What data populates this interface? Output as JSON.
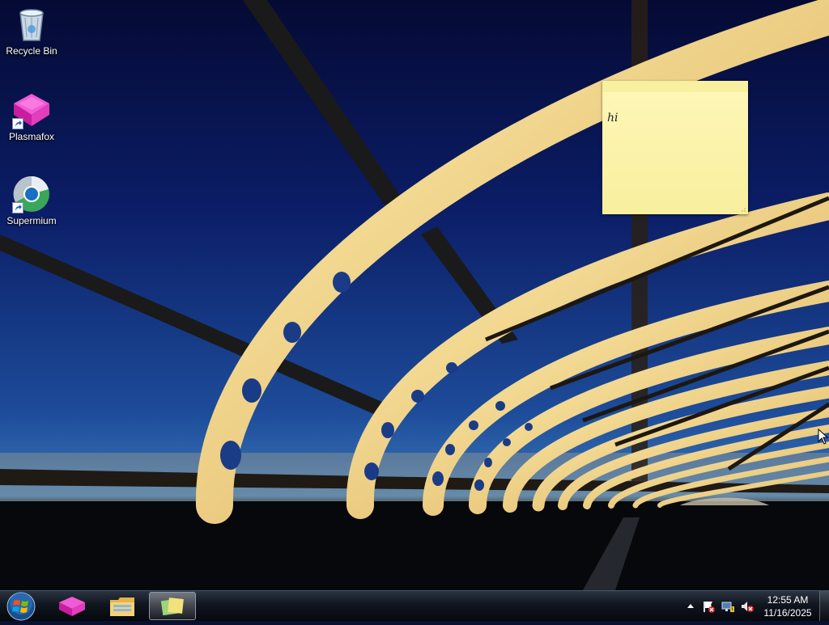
{
  "desktop": {
    "icons": [
      {
        "label": "Recycle Bin",
        "icon": "recycle-bin-icon"
      },
      {
        "label": "Plasmafox",
        "icon": "plasmafox-icon"
      },
      {
        "label": "Supermium",
        "icon": "supermium-icon"
      }
    ]
  },
  "sticky_note": {
    "text": "hi",
    "color": "#fdf6b6"
  },
  "taskbar": {
    "start_icon": "windows-start-orb-icon",
    "pinned": [
      {
        "app": "Plasmafox",
        "icon": "plasmafox-icon",
        "active": false
      },
      {
        "app": "Windows Explorer",
        "icon": "folder-explorer-icon",
        "active": false
      },
      {
        "app": "Sticky Notes",
        "icon": "sticky-notes-icon",
        "active": true
      }
    ],
    "tray": {
      "icons": [
        "show-hidden-icons-chevron",
        "action-center-flag-icon",
        "network-icon",
        "volume-muted-icon"
      ]
    },
    "clock": {
      "time": "12:55 AM",
      "date": "11/16/2025"
    }
  },
  "colors": {
    "taskbar": "#10161f",
    "sky_top": "#06103a",
    "sky_bottom": "#2c5fa8",
    "bridge": "#f3d98a"
  }
}
